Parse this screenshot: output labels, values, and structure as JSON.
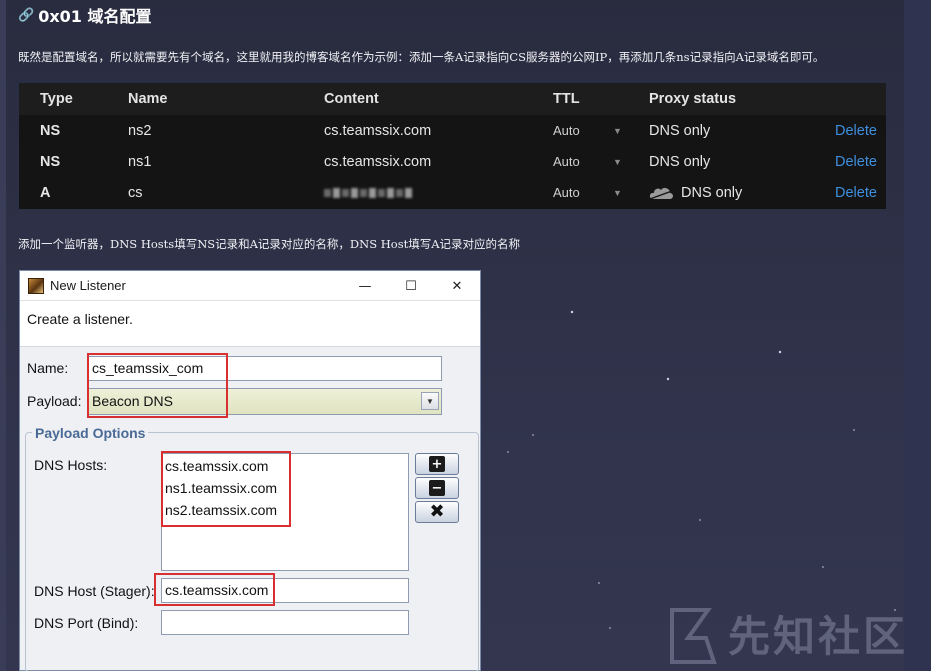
{
  "article": {
    "heading": "0x01 域名配置",
    "para1": "既然是配置域名，所以就需要先有个域名，这里就用我的博客域名作为示例：添加一条A记录指向CS服务器的公网IP，再添加几条ns记录指向A记录域名即可。",
    "para2": "添加一个监听器，DNS Hosts填写NS记录和A记录对应的名称，DNS Host填写A记录对应的名称"
  },
  "dns_table": {
    "headers": {
      "type": "Type",
      "name": "Name",
      "content": "Content",
      "ttl": "TTL",
      "proxy": "Proxy status"
    },
    "rows": [
      {
        "type": "NS",
        "name": "ns2",
        "content": "cs.teamssix.com",
        "ttl": "Auto",
        "proxy": "DNS only",
        "action": "Delete"
      },
      {
        "type": "NS",
        "name": "ns1",
        "content": "cs.teamssix.com",
        "ttl": "Auto",
        "proxy": "DNS only",
        "action": "Delete"
      },
      {
        "type": "A",
        "name": "cs",
        "content": "",
        "ttl": "Auto",
        "proxy": "DNS only",
        "action": "Delete"
      }
    ],
    "colors": {
      "background": "#141414",
      "header": "#1d1d1d",
      "link": "#3e8fde"
    }
  },
  "window": {
    "title": "New Listener",
    "controls": {
      "minimize": "—",
      "maximize": "☐",
      "close": "✕"
    },
    "banner": "Create a listener.",
    "name_label": "Name:",
    "name_value": "cs_teamssix_com",
    "payload_label": "Payload:",
    "payload_value": "Beacon DNS",
    "options_title": "Payload Options",
    "dns_hosts_label": "DNS Hosts:",
    "dns_hosts": [
      "cs.teamssix.com",
      "ns1.teamssix.com",
      "ns2.teamssix.com"
    ],
    "stager_label": "DNS Host (Stager):",
    "stager_value": "cs.teamssix.com",
    "port_label": "DNS Port (Bind):",
    "port_value": "",
    "buttons": {
      "add": "+",
      "remove": "−",
      "clear": "✖"
    }
  },
  "watermark": {
    "text": "先知社区"
  },
  "icons": [
    "link-icon",
    "cloud-icon",
    "app-icon",
    "dropdown-arrow-icon",
    "plus-icon",
    "minus-icon",
    "clear-icon"
  ]
}
